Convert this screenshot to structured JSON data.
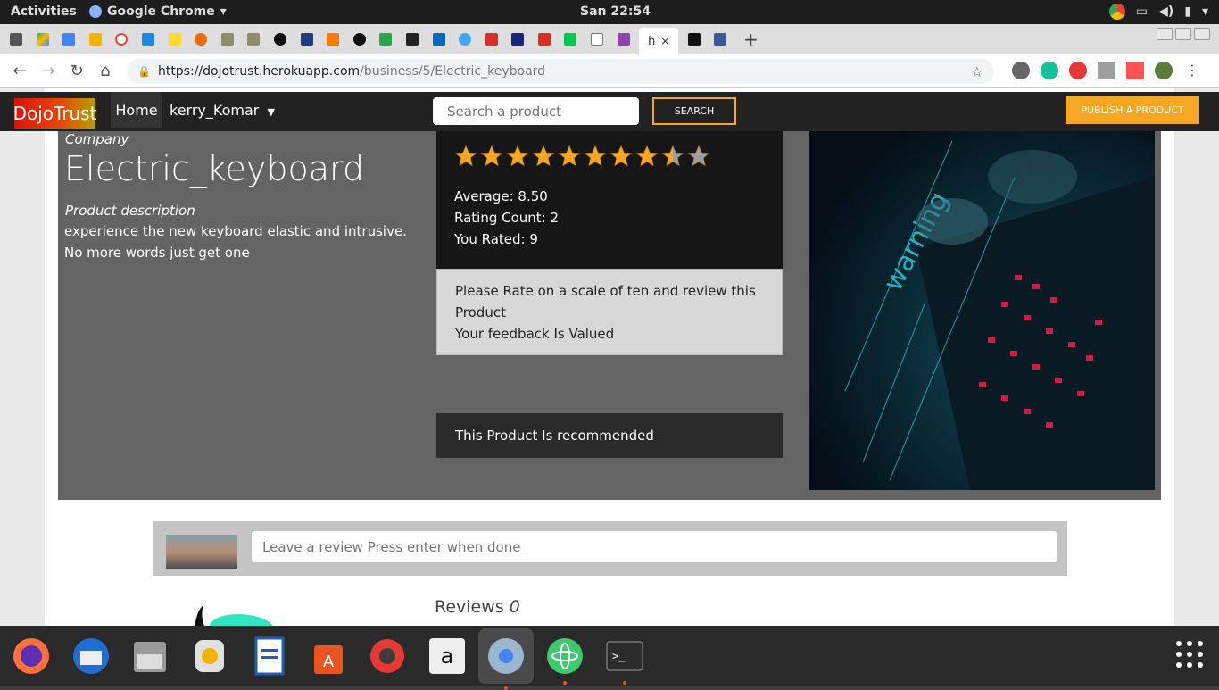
{
  "os": {
    "activities": "Activities",
    "app_name": "Google Chrome",
    "clock": "San 22:54"
  },
  "browser": {
    "url_host": "https://dojotrust.herokuapp.com",
    "url_path": "/business/5/Electric_keyboard"
  },
  "nav": {
    "brand": "DojoTrust",
    "home": "Home",
    "user": "kerry_Komar",
    "search_placeholder": "Search a product",
    "search_button": "SEARCH",
    "publish_button": "PUBLISH A PRODUCT"
  },
  "product": {
    "company_label": "Company",
    "name": "Electric_keyboard",
    "description_label": "Product description",
    "description": "experience the new keyboard elastic and intrusive. No more words just get one",
    "rating_out_of": 10,
    "rating": 8.5,
    "average": "Average: 8.50",
    "rating_count": "Rating Count: 2",
    "you_rated": "You Rated: 9",
    "rate_prompt_1": "Please Rate on a scale of ten and review this Product",
    "rate_prompt_2": "Your feedback Is Valued",
    "recommended": "This Product Is recommended"
  },
  "reviews": {
    "input_placeholder": "Leave a review Press enter when done",
    "label": "Reviews",
    "count": "0"
  },
  "colors": {
    "accent": "#f5a623",
    "star": "#f5a623",
    "star_empty": "#9e9e9e"
  }
}
